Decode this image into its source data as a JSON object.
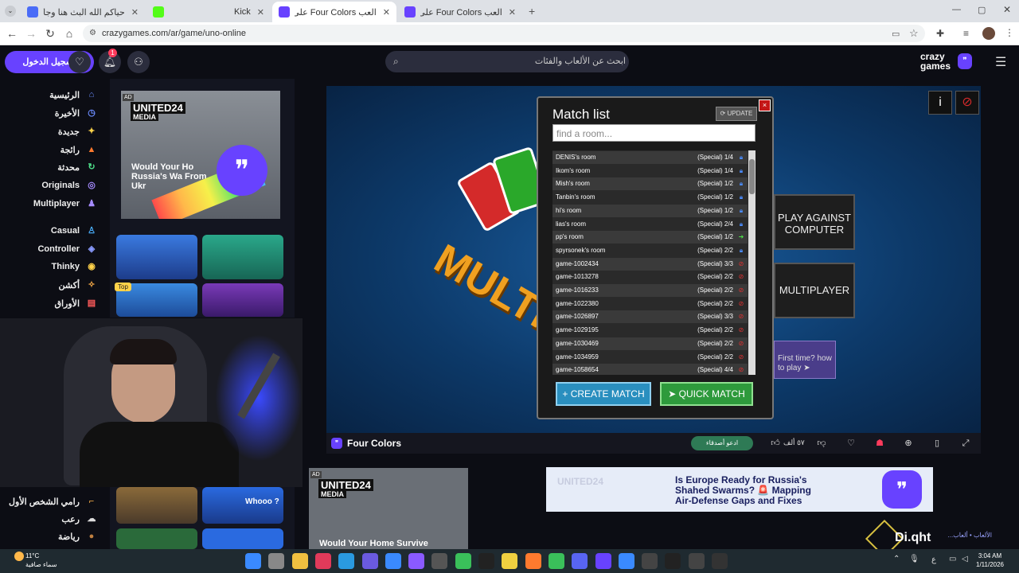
{
  "browser": {
    "tabs": [
      {
        "title": "حياكم الله البث هنا وجاكو (TWRX)",
        "icon_color": "#4a6cf7"
      },
      {
        "title": "Kick",
        "icon_color": "#53fc18"
      },
      {
        "title": "العب Four Colors على كريز",
        "icon_color": "#6842ff"
      },
      {
        "title": "العب Four Colors على كريز",
        "icon_color": "#6842ff"
      }
    ],
    "url": "crazygames.com/ar/game/uno-online"
  },
  "header": {
    "login_label": "تسجيل الدخول",
    "notification_count": "1",
    "search_placeholder": "ابحث عن الألعاب والفئات",
    "logo_line1": "crazy",
    "logo_line2": "games"
  },
  "sidebar": {
    "items": [
      {
        "label": "الرئيسية",
        "icon": "home-icon",
        "glyph": "⌂",
        "color": "#6b8cff"
      },
      {
        "label": "الأخيرة",
        "icon": "clock-icon",
        "glyph": "◷",
        "color": "#6b8cff"
      },
      {
        "label": "جديدة",
        "icon": "sparkle-icon",
        "glyph": "✦",
        "color": "#ffd24a"
      },
      {
        "label": "رائجة",
        "icon": "fire-icon",
        "glyph": "▲",
        "color": "#ff7a2e"
      },
      {
        "label": "محدثة",
        "icon": "refresh-icon",
        "glyph": "↻",
        "color": "#4ee08a"
      },
      {
        "label": "Originals",
        "icon": "originals-icon",
        "glyph": "◎",
        "color": "#a58bff"
      },
      {
        "label": "Multiplayer",
        "icon": "multiplayer-icon",
        "glyph": "♟",
        "color": "#a58bff"
      },
      {
        "label": "Casual",
        "icon": "casual-icon",
        "glyph": "♙",
        "color": "#4ab0ff"
      },
      {
        "label": "Controller",
        "icon": "controller-icon",
        "glyph": "◈",
        "color": "#8a9bff"
      },
      {
        "label": "Thinky",
        "icon": "thinky-icon",
        "glyph": "◉",
        "color": "#ffd24a"
      },
      {
        "label": "أكشن",
        "icon": "action-icon",
        "glyph": "✧",
        "color": "#ffb04a"
      },
      {
        "label": "الأوراق",
        "icon": "cards-icon",
        "glyph": "▤",
        "color": "#ff5a5a"
      }
    ],
    "lower_items": [
      {
        "label": "رامي الشخص الأول",
        "icon": "gun-icon",
        "glyph": "⌐",
        "color": "#ffb04a"
      },
      {
        "label": "رعب",
        "icon": "ghost-icon",
        "glyph": "☁",
        "color": "#dddddd"
      },
      {
        "label": "رياضة",
        "icon": "ball-icon",
        "glyph": "●",
        "color": "#c08040"
      }
    ]
  },
  "ads": {
    "ad_label": "AD",
    "ad1_brand": "UNITED24",
    "ad1_sub": "MEDIA",
    "ad1_text": "Would Your Ho Russia's Wa From Ukr",
    "ad2_text": "Would Your Home Survive",
    "ad3_text": "Is Europe Ready for Russia's Shahed Swarms? 🚨 Mapping Air-Defense Gaps and Fixes"
  },
  "thumbnails": {
    "top_pick_label": "Top",
    "whoo_label": "Whooo ?"
  },
  "game": {
    "match_list_title": "Match list",
    "update_label": "UPDATE",
    "close_label": "×",
    "find_room_placeholder": "find a room...",
    "rooms": [
      {
        "name": "DENIS's room",
        "info": "(Special) 1/4",
        "status": "locked"
      },
      {
        "name": "Ikom's room",
        "info": "(Special) 1/4",
        "status": "locked"
      },
      {
        "name": "Mish's room",
        "info": "(Special) 1/2",
        "status": "locked"
      },
      {
        "name": "Tanbin's room",
        "info": "(Special) 1/2",
        "status": "locked"
      },
      {
        "name": "hi's room",
        "info": "(Special) 1/2",
        "status": "locked"
      },
      {
        "name": "lias's room",
        "info": "(Special) 2/4",
        "status": "locked"
      },
      {
        "name": "pp's room",
        "info": "(Special) 1/2",
        "status": "open"
      },
      {
        "name": "spyrsonek's room",
        "info": "(Special) 2/2",
        "status": "locked"
      },
      {
        "name": "game-1002434",
        "info": "(Special) 3/3",
        "status": "full"
      },
      {
        "name": "game-1013278",
        "info": "(Special) 2/2",
        "status": "full"
      },
      {
        "name": "game-1016233",
        "info": "(Special) 2/2",
        "status": "full"
      },
      {
        "name": "game-1022380",
        "info": "(Special) 2/2",
        "status": "full"
      },
      {
        "name": "game-1026897",
        "info": "(Special) 3/3",
        "status": "full"
      },
      {
        "name": "game-1029195",
        "info": "(Special) 2/2",
        "status": "full"
      },
      {
        "name": "game-1030469",
        "info": "(Special) 2/2",
        "status": "full"
      },
      {
        "name": "game-1034959",
        "info": "(Special) 2/2",
        "status": "full"
      },
      {
        "name": "game-1058654",
        "info": "(Special) 4/4",
        "status": "full"
      }
    ],
    "create_match_label": "+ CREATE MATCH",
    "quick_match_label": "➤ QUICK MATCH",
    "play_computer_label": "PLAY AGAINST COMPUTER",
    "multiplayer_label": "MULTIPLAYER",
    "first_time_label": "First time? how to play ➤",
    "logo_text": "MULTI",
    "info_icon": "i",
    "status_colors": {
      "locked": "#4a8cff",
      "open": "#4ee04a",
      "full": "#e03030"
    }
  },
  "gamebar": {
    "title": "Four Colors",
    "invite_label": "ادعو أصدقاء",
    "likes": "٥٧ ألف"
  },
  "overlay": {
    "watermark": "Di.qht"
  },
  "taskbar": {
    "temperature": "11°C",
    "weather": "سماء صافية",
    "time": "3:04 AM",
    "date": "1/11/2026",
    "lang": "ع"
  },
  "breadcrumb": "الألعاب • ألعاب..."
}
